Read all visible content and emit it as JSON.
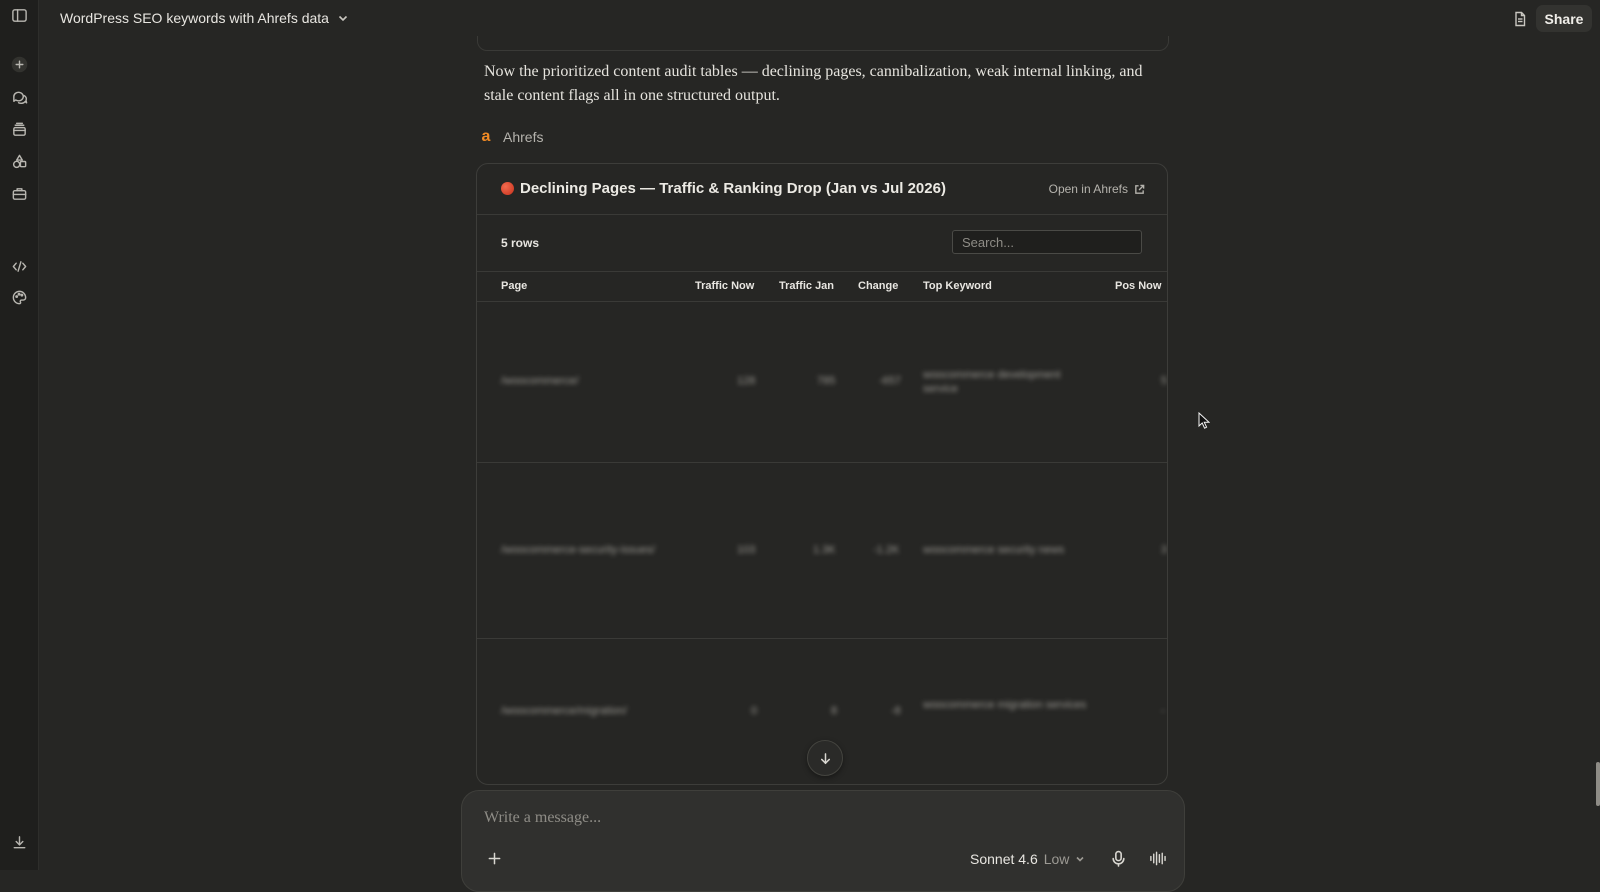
{
  "app": {
    "title": "WordPress SEO keywords with Ahrefs data",
    "share_label": "Share"
  },
  "sidebar": {
    "icons": [
      "sidebar-toggle-icon",
      "new-chat-icon",
      "chats-icon",
      "projects-icon",
      "artifacts-icon",
      "toolbox-icon",
      "code-icon",
      "palette-icon",
      "download-icon"
    ]
  },
  "message": {
    "intro": "Now the prioritized content audit tables — declining pages, cannibalization, weak internal linking, and stale content flags all in one structured output.",
    "tool_name": "Ahrefs",
    "tool_logo": "a"
  },
  "card": {
    "title": "Declining Pages — Traffic & Ranking Drop (Jan vs Jul 2026)",
    "open_link": "Open in Ahrefs",
    "rows_label": "5 rows",
    "search_placeholder": "Search...",
    "columns": [
      "Page",
      "Traffic Now",
      "Traffic Jan",
      "Change",
      "Top Keyword",
      "Pos Now"
    ],
    "rows": [
      {
        "page": "/woocommerce/",
        "traffic_now": "128",
        "traffic_jan": "785",
        "change": "-657",
        "top_keyword": "woocommerce development service",
        "pos_now": "5"
      },
      {
        "page": "/woocommerce-security-issues/",
        "traffic_now": "103",
        "traffic_jan": "1.3K",
        "change": "-1.2K",
        "top_keyword": "woocommerce security news",
        "pos_now": "3"
      },
      {
        "page": "/woocommerce/migration/",
        "traffic_now": "0",
        "traffic_jan": "8",
        "change": "-8",
        "top_keyword": "woocommerce migration services",
        "pos_now": "-"
      }
    ]
  },
  "composer": {
    "placeholder": "Write a message...",
    "model": "Sonnet 4.6",
    "effort": "Low"
  },
  "colors": {
    "background": "#262624",
    "sidebar": "#1f1f1d",
    "accent_ahrefs": "#f08a24",
    "declining_dot": "#d93b22"
  }
}
